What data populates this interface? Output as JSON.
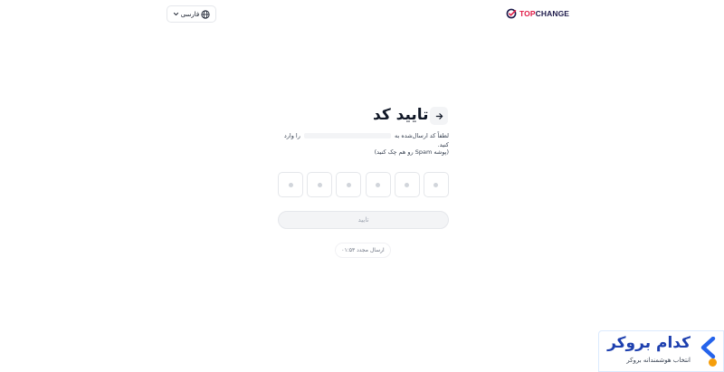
{
  "header": {
    "logo_top": "TOP",
    "logo_change": "CHANGE",
    "language_label": "فارسی"
  },
  "main": {
    "title": "تایید کد",
    "description_prefix": "لطفاً کد ارسال‌شده به",
    "description_suffix": "را وارد کنید.",
    "spam_note": "(پوشه Spam رو هم چک کنید)",
    "otp_length": 6,
    "submit_label": "تایید",
    "resend_label": "ارسال مجدد ۰۱:۵۳"
  },
  "ad": {
    "title": "کدام بروکر",
    "subtitle": "انتخاب هوشمندانه بروکر"
  },
  "colors": {
    "accent": "#e11d48",
    "brand_dark": "#1e1b4b",
    "ad_blue": "#1e40af",
    "ad_orange": "#f59e0b"
  },
  "icons": {
    "logo": "checkmark-circle-icon",
    "language": "globe-icon",
    "dropdown": "chevron-down-icon",
    "back": "arrow-right-icon",
    "ad": "chevron-left-icon"
  }
}
